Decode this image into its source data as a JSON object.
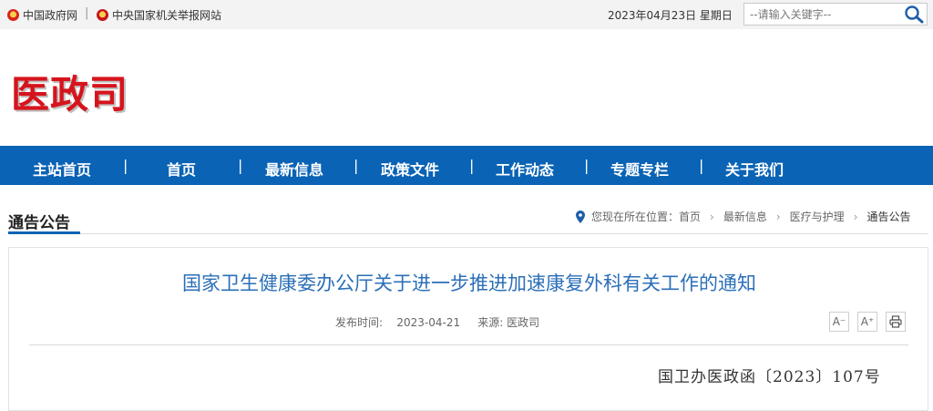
{
  "topbar": {
    "links": [
      "中国政府网",
      "中央国家机关举报网站"
    ],
    "separator": "|",
    "date": "2023年04月23日 星期日",
    "search_placeholder": "--请输入关键字--"
  },
  "logo": "医政司",
  "nav": {
    "items": [
      "主站首页",
      "首页",
      "最新信息",
      "政策文件",
      "工作动态",
      "专题专栏",
      "关于我们"
    ],
    "separator": "|"
  },
  "section": {
    "title": "通告公告",
    "breadcrumb_prefix": "您现在所在位置：",
    "breadcrumb": [
      "首页",
      "最新信息",
      "医疗与护理",
      "通告公告"
    ],
    "breadcrumb_sep": "›"
  },
  "article": {
    "title": "国家卫生健康委办公厅关于进一步推进加速康复外科有关工作的通知",
    "publish_label": "发布时间:",
    "publish_date": "2023-04-21",
    "source_label": "来源:",
    "source": "医政司",
    "font_smaller": "A⁻",
    "font_larger": "A⁺",
    "doc_number": "国卫办医政函〔2023〕107号"
  },
  "colors": {
    "nav_bg": "#0a63b4",
    "logo": "#d6141d",
    "title": "#2b6fb8"
  }
}
